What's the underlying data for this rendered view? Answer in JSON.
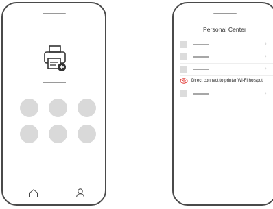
{
  "left_phone": {
    "center_icon": "printer-add-icon",
    "tabbar": {
      "home_icon": "home-icon",
      "user_icon": "user-icon"
    },
    "placeholder_circle_count": 6
  },
  "right_phone": {
    "title": "Personal Center",
    "list_items": [
      {
        "icon": "placeholder-icon",
        "label": ""
      },
      {
        "icon": "placeholder-icon",
        "label": ""
      },
      {
        "icon": "placeholder-icon",
        "label": ""
      },
      {
        "icon": "wifi-link-icon",
        "label": "Direct connect to printer Wi-Fi hotspot",
        "accent": "#e0312d"
      },
      {
        "icon": "placeholder-icon",
        "label": ""
      }
    ]
  }
}
